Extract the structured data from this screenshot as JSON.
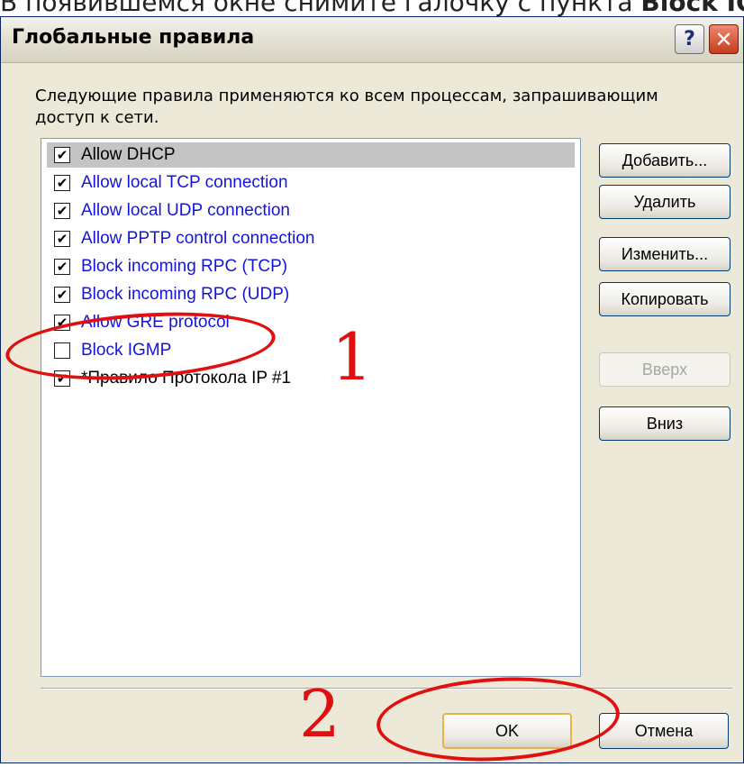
{
  "caption": {
    "text_prefix": "В появившемся окне снимите галочку с пункта ",
    "text_bold": "Block IGM"
  },
  "window": {
    "title": "Глобальные правила",
    "help_label": "?",
    "close_label": "✕"
  },
  "description": "Следующие правила применяются ко всем процессам, запрашивающим доступ к сети.",
  "rules": [
    {
      "label": "Allow DHCP",
      "checked": true,
      "selected": true,
      "color": "black"
    },
    {
      "label": "Allow local TCP connection",
      "checked": true,
      "selected": false,
      "color": "blue"
    },
    {
      "label": "Allow local UDP connection",
      "checked": true,
      "selected": false,
      "color": "blue"
    },
    {
      "label": "Allow PPTP control connection",
      "checked": true,
      "selected": false,
      "color": "blue"
    },
    {
      "label": "Block incoming RPC (TCP)",
      "checked": true,
      "selected": false,
      "color": "blue"
    },
    {
      "label": "Block incoming RPC (UDP)",
      "checked": true,
      "selected": false,
      "color": "blue"
    },
    {
      "label": "Allow GRE protocol",
      "checked": true,
      "selected": false,
      "color": "blue"
    },
    {
      "label": "Block IGMP",
      "checked": false,
      "selected": false,
      "color": "blue"
    },
    {
      "label": "*Правило Протокола IP #1",
      "checked": true,
      "selected": false,
      "color": "black"
    }
  ],
  "side_buttons": {
    "add": "Добавить...",
    "delete": "Удалить",
    "edit": "Изменить...",
    "copy": "Копировать",
    "up": "Вверх",
    "down": "Вниз"
  },
  "bottom_buttons": {
    "ok": "OK",
    "cancel": "Отмена"
  },
  "annotations": {
    "marker_1": "1",
    "marker_2": "2",
    "color": "#e01010"
  },
  "colors": {
    "rule_blue": "#1515d8",
    "dialog_bg": "#ece9d8"
  }
}
